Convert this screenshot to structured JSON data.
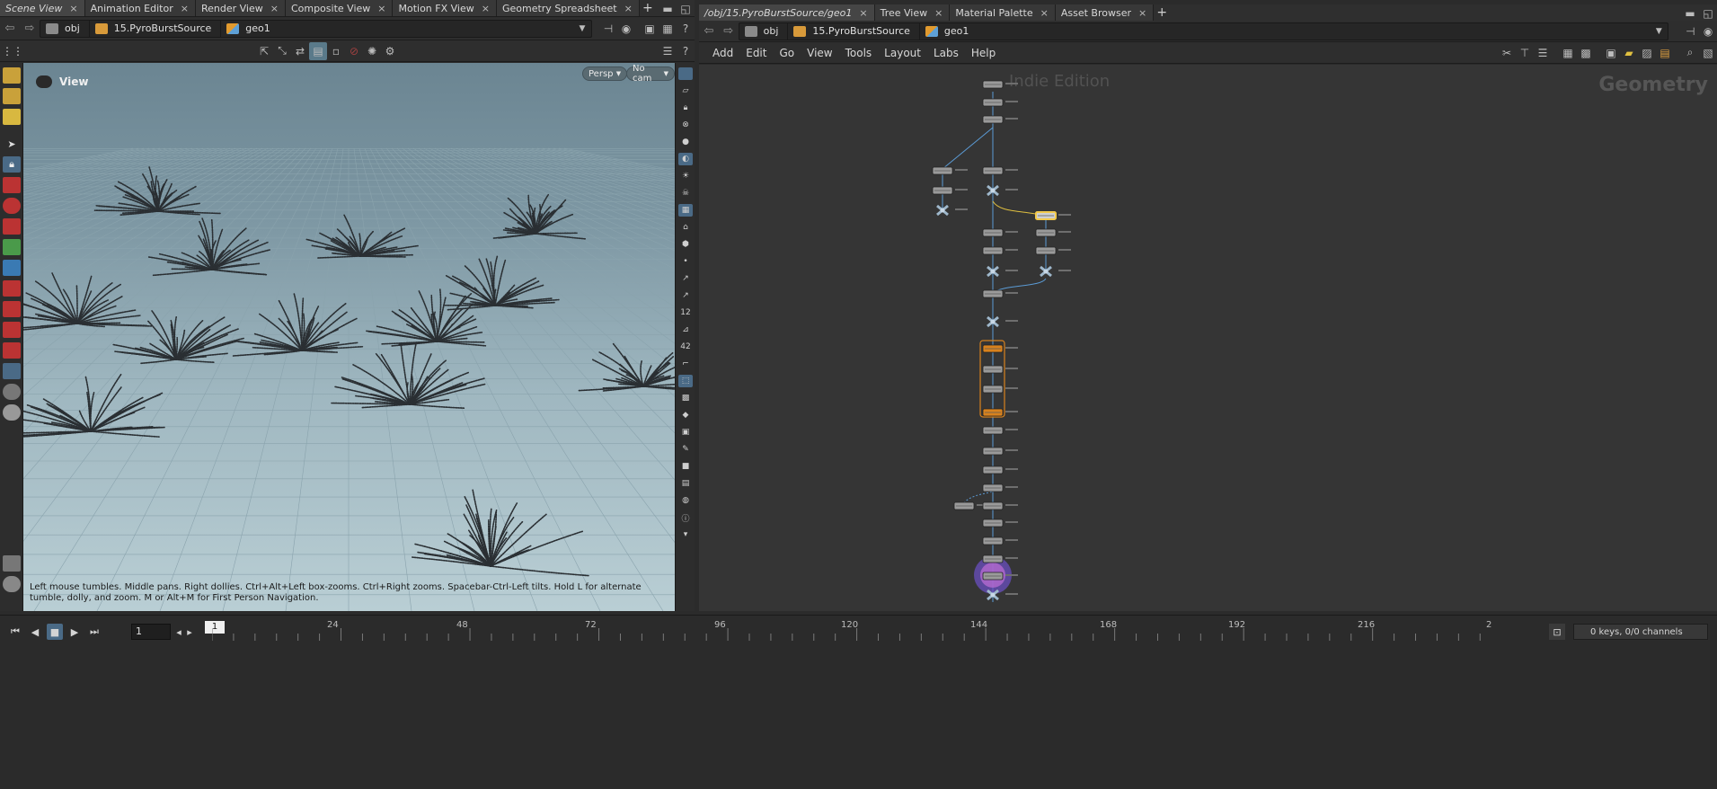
{
  "left_pane": {
    "tabs": [
      "Scene View",
      "Animation Editor",
      "Render View",
      "Composite View",
      "Motion FX View",
      "Geometry Spreadsheet"
    ],
    "path": [
      "obj",
      "15.PyroBurstSource",
      "geo1"
    ]
  },
  "viewport": {
    "title": "View",
    "camera_mode": "Persp",
    "camera_menu": "No cam",
    "help_text": "Left mouse tumbles. Middle pans. Right dollies. Ctrl+Alt+Left box-zooms. Ctrl+Right zooms. Spacebar-Ctrl-Left tilts. Hold L for alternate tumble, dolly, and zoom. M or Alt+M for First Person Navigation."
  },
  "right_pane": {
    "tabs": [
      "/obj/15.PyroBurstSource/geo1",
      "Tree View",
      "Material Palette",
      "Asset Browser"
    ],
    "path": [
      "obj",
      "15.PyroBurstSource",
      "geo1"
    ],
    "menu": [
      "Add",
      "Edit",
      "Go",
      "View",
      "Tools",
      "Layout",
      "Labs",
      "Help"
    ],
    "watermark": "Indie Edition",
    "network_label": "Geometry"
  },
  "timeline": {
    "current_frame": "1",
    "frame_field": "1",
    "ticks": [
      "24",
      "48",
      "72",
      "96",
      "120",
      "144",
      "168",
      "192",
      "216",
      "2"
    ],
    "keys_info": "0 keys, 0/0 channels"
  },
  "colors": {
    "node_default": "#9a9a9a",
    "node_selected": "#f2c94c",
    "node_orange": "#d8821e",
    "wire": "#5b9bd5",
    "display_flag": "#8a6fd1"
  }
}
